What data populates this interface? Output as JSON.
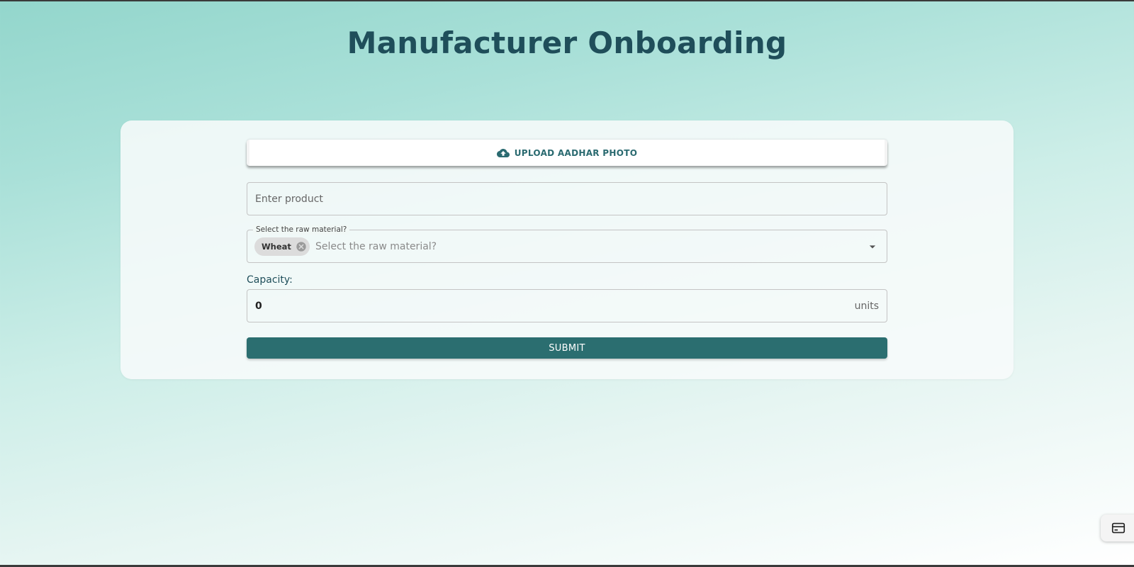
{
  "header": {
    "title": "Manufacturer Onboarding"
  },
  "form": {
    "upload_button": {
      "label": "UPLOAD AADHAR PHOTO",
      "icon": "cloud-upload-icon"
    },
    "product_field": {
      "value": "",
      "placeholder": "Enter product"
    },
    "raw_material_select": {
      "label": "Select the raw material?",
      "placeholder": "Select the raw material?",
      "selected_chips": [
        {
          "label": "Wheat",
          "delete_icon": "cancel-icon"
        }
      ],
      "dropdown_icon": "arrow-drop-down-icon"
    },
    "capacity": {
      "label": "Capacity:",
      "value": "0",
      "unit": "units"
    },
    "submit_label": "SUBMIT"
  },
  "floating_action": {
    "icon": "card-icon"
  },
  "colors": {
    "title": "#1f4e5a",
    "accent": "#2b6e70",
    "upload_text": "#2a6a70",
    "background_top": "#93d6cc",
    "background_bottom": "#ffffff"
  }
}
